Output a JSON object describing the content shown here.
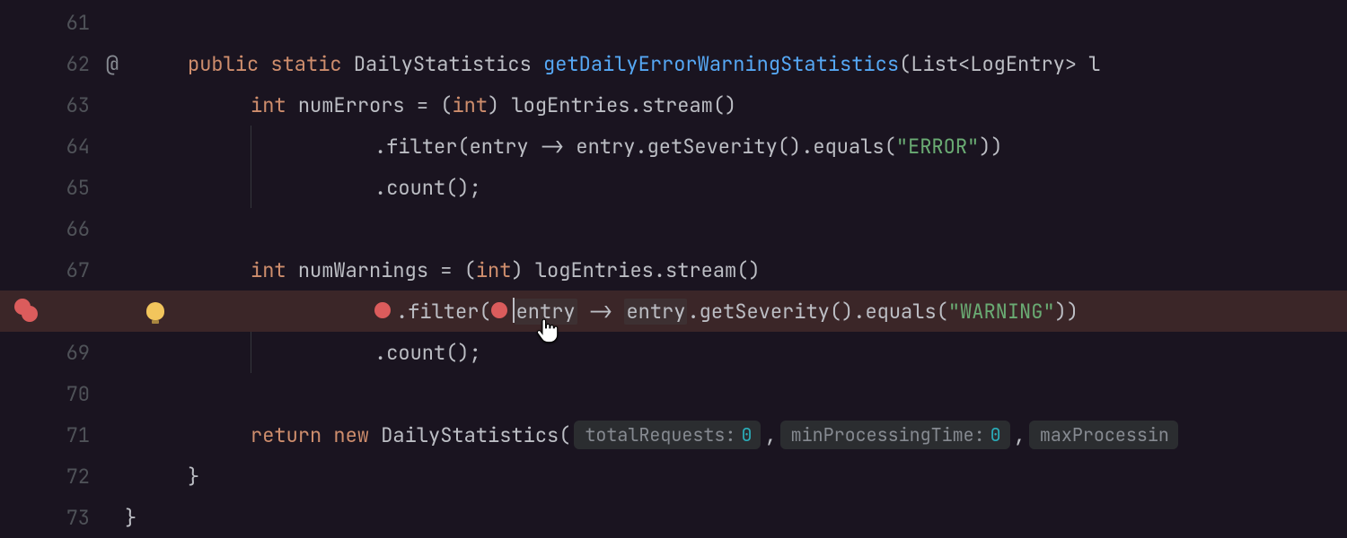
{
  "gutter": {
    "lines": [
      "61",
      "62",
      "63",
      "64",
      "65",
      "66",
      "67",
      "",
      "69",
      "70",
      "71",
      "72",
      "73"
    ],
    "annotation_at": "@"
  },
  "code": {
    "l62": {
      "kw_public": "public",
      "kw_static": "static",
      "type": "DailyStatistics",
      "method": "getDailyErrorWarningStatistics",
      "params_prefix": "(List<LogEntry> l"
    },
    "l63": {
      "kw_int": "int",
      "ident": "numErrors",
      "eq": " = (",
      "cast": "int",
      "after_cast": ") logEntries.stream()"
    },
    "l64": {
      "call": ".filter(entry -> entry.getSeverity().equals(",
      "str": "\"ERROR\"",
      "close": "))"
    },
    "l65": {
      "text": ".count();"
    },
    "l67": {
      "kw_int": "int",
      "ident": "numWarnings",
      "eq": " = (",
      "cast": "int",
      "after_cast": ") logEntries.stream()"
    },
    "l68": {
      "call_pre": ".filter(",
      "entry1": "entry",
      "arrow": " -> ",
      "entry2": "entry",
      "chain": ".getSeverity().equals(",
      "str": "\"WARNING\"",
      "close": "))"
    },
    "l69": {
      "text": ".count();"
    },
    "l71": {
      "kw_return": "return",
      "kw_new": "new",
      "type": "DailyStatistics",
      "open": "(",
      "hint1_label": "totalRequests:",
      "hint1_val": "0",
      "comma1": ",",
      "hint2_label": "minProcessingTime:",
      "hint2_val": "0",
      "comma2": ",",
      "hint3_label": "maxProcessin"
    },
    "l72": {
      "brace": "}"
    },
    "l73": {
      "brace": "}"
    }
  }
}
